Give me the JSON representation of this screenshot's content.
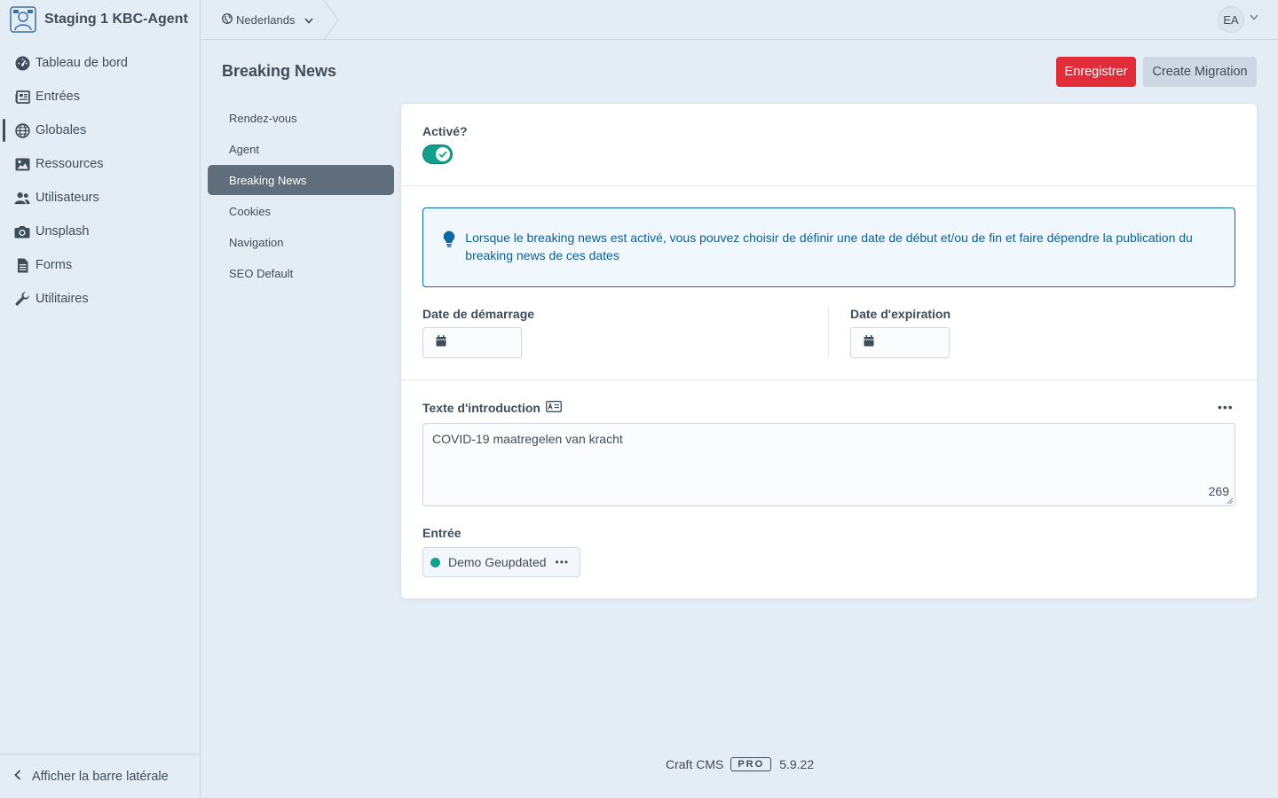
{
  "app": {
    "site_name": "Staging 1 KBC-Agent"
  },
  "sidebar": {
    "items": [
      {
        "label": "Tableau de bord",
        "icon": "gauge-icon"
      },
      {
        "label": "Entrées",
        "icon": "newspaper-icon"
      },
      {
        "label": "Globales",
        "icon": "globe-icon",
        "active": true
      },
      {
        "label": "Ressources",
        "icon": "image-icon"
      },
      {
        "label": "Utilisateurs",
        "icon": "users-icon"
      },
      {
        "label": "Unsplash",
        "icon": "camera-icon"
      },
      {
        "label": "Forms",
        "icon": "document-icon"
      },
      {
        "label": "Utilitaires",
        "icon": "wrench-icon"
      }
    ],
    "footer_label": "Afficher la barre latérale"
  },
  "header": {
    "site_switch": "Nederlands",
    "avatar_initials": "EA"
  },
  "page": {
    "title": "Breaking News",
    "save_label": "Enregistrer",
    "migration_label": "Create Migration"
  },
  "subnav": {
    "items": [
      "Rendez-vous",
      "Agent",
      "Breaking News",
      "Cookies",
      "Navigation",
      "SEO Default"
    ],
    "selected_index": 2
  },
  "form": {
    "enabled_label": "Activé?",
    "enabled": true,
    "tip_text": "Lorsque le breaking news est activé, vous pouvez choisir de définir une date de début et/ou de fin et faire dépendre la publication du breaking news de ces dates",
    "start_date_label": "Date de démarrage",
    "end_date_label": "Date d'expiration",
    "intro_label": "Texte d'introduction",
    "intro_value": "COVID-19 maatregelen van kracht",
    "intro_char_count": "269",
    "entry_label": "Entrée",
    "entry_value": "Demo Geupdated"
  },
  "footer": {
    "product": "Craft CMS",
    "edition": "PRO",
    "version": "5.9.22"
  },
  "colors": {
    "accent_red": "#e12d39",
    "toggle_on": "#10a08c",
    "tip_blue": "#0b69a3"
  }
}
